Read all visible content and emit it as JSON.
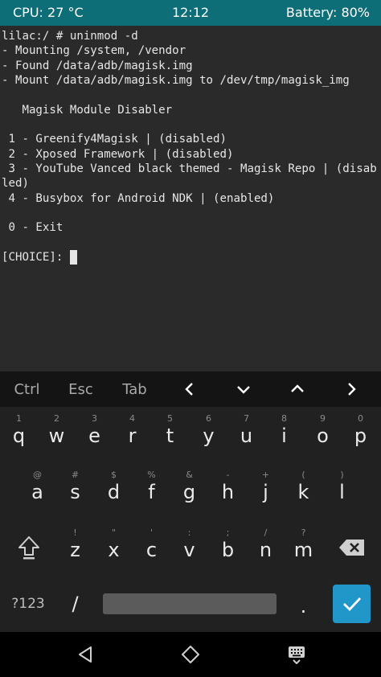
{
  "status_bar": {
    "cpu": "CPU: 27 °C",
    "time": "12:12",
    "battery": "Battery: 80%"
  },
  "terminal": {
    "lines": [
      "lilac:/ # uninmod -d",
      "- Mounting /system, /vendor",
      "- Found /data/adb/magisk.img",
      "- Mount /data/adb/magisk.img to /dev/tmp/magisk_img",
      "",
      "   Magisk Module Disabler",
      "",
      " 1 - Greenify4Magisk | (disabled)",
      " 2 - Xposed Framework | (disabled)",
      " 3 - YouTube Vanced black themed - Magisk Repo | (disab",
      "led)",
      " 4 - Busybox for Android NDK | (enabled)",
      "",
      " 0 - Exit",
      "",
      "[CHOICE]: "
    ]
  },
  "extra_keys": {
    "ctrl": "Ctrl",
    "esc": "Esc",
    "tab": "Tab",
    "left": "left-arrow",
    "down": "down-arrow",
    "up": "up-arrow",
    "right": "right-arrow"
  },
  "keyboard": {
    "row1": [
      {
        "key": "q",
        "hint": "1"
      },
      {
        "key": "w",
        "hint": "2"
      },
      {
        "key": "e",
        "hint": "3"
      },
      {
        "key": "r",
        "hint": "4"
      },
      {
        "key": "t",
        "hint": "5"
      },
      {
        "key": "y",
        "hint": "6"
      },
      {
        "key": "u",
        "hint": "7"
      },
      {
        "key": "i",
        "hint": "8"
      },
      {
        "key": "o",
        "hint": "9"
      },
      {
        "key": "p",
        "hint": "0"
      }
    ],
    "row2": [
      {
        "key": "a",
        "hint": "@"
      },
      {
        "key": "s",
        "hint": "#"
      },
      {
        "key": "d",
        "hint": "$"
      },
      {
        "key": "f",
        "hint": "%"
      },
      {
        "key": "g",
        "hint": "&"
      },
      {
        "key": "h",
        "hint": "-"
      },
      {
        "key": "j",
        "hint": "+"
      },
      {
        "key": "k",
        "hint": "("
      },
      {
        "key": "l",
        "hint": ")"
      }
    ],
    "row3": [
      {
        "key": "z",
        "hint": "!"
      },
      {
        "key": "x",
        "hint": "\""
      },
      {
        "key": "c",
        "hint": "'"
      },
      {
        "key": "v",
        "hint": ":"
      },
      {
        "key": "b",
        "hint": ";"
      },
      {
        "key": "n",
        "hint": "/"
      },
      {
        "key": "m",
        "hint": "?"
      }
    ],
    "symbols_key": "?123",
    "slash_key": "/",
    "period_key": ".",
    "shift_icon": "shift-icon",
    "backspace_icon": "backspace-icon",
    "enter_icon": "checkmark-icon"
  },
  "nav_bar": {
    "back_icon": "back-triangle-icon",
    "home_icon": "home-icon",
    "keyboard_icon": "keyboard-icon"
  },
  "colors": {
    "status_bar": "#0d6e78",
    "terminal_bg": "#2a2a2a",
    "keyboard_bg": "#212121",
    "enter_key": "#2196c8"
  }
}
